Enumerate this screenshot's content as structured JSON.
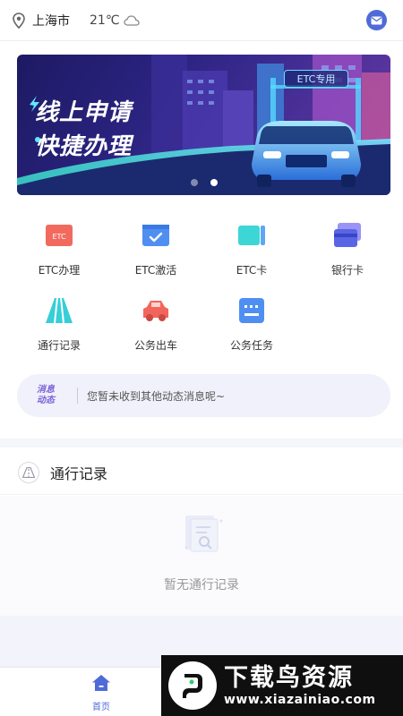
{
  "header": {
    "city": "上海市",
    "temperature": "21℃",
    "location_icon": "location-pin-icon",
    "weather_icon": "cloud-icon",
    "mail_icon": "mail-icon"
  },
  "banner": {
    "slogan_line1": "线上申请",
    "slogan_line2": "快捷办理",
    "sign_text": "ETC专用",
    "active_slide": 2,
    "slide_count": 2
  },
  "quick_actions": [
    {
      "label": "ETC办理",
      "icon": "etc-card-red-icon",
      "icon_text": "ETC"
    },
    {
      "label": "ETC激活",
      "icon": "etc-activate-icon"
    },
    {
      "label": "ETC卡",
      "icon": "etc-card-icon"
    },
    {
      "label": "银行卡",
      "icon": "bank-card-icon"
    },
    {
      "label": "通行记录",
      "icon": "road-icon"
    },
    {
      "label": "公务出车",
      "icon": "car-icon"
    },
    {
      "label": "公务任务",
      "icon": "task-icon"
    }
  ],
  "notice": {
    "tag_line1": "消息",
    "tag_line2": "动态",
    "text": "您暂未收到其他动态消息呢~"
  },
  "records_section": {
    "title": "通行记录",
    "empty_text": "暂无通行记录"
  },
  "tabbar": {
    "home_label": "首页"
  },
  "watermark": {
    "title": "下载鸟资源",
    "url": "www.xiazainiao.com"
  },
  "colors": {
    "accent": "#4e6bd8",
    "notice_tag": "#7c62d8",
    "banner_bg": "#2b2380"
  }
}
